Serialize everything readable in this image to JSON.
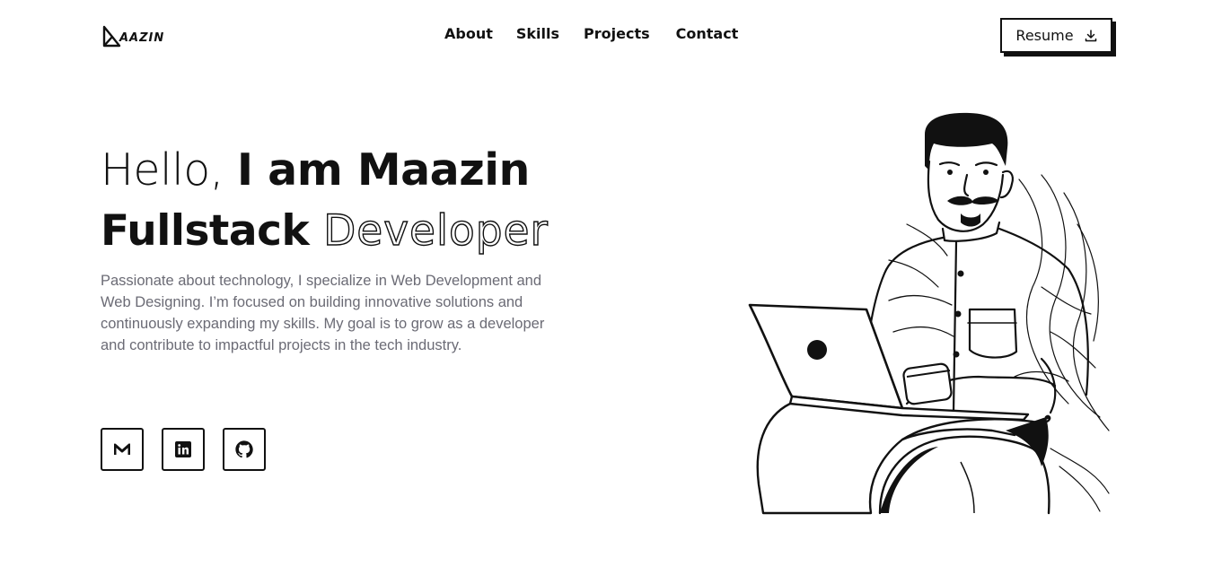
{
  "logo": {
    "text": "AAZIN",
    "icon": "m-monogram-icon"
  },
  "nav": {
    "items": [
      {
        "label": "About"
      },
      {
        "label": "Skills"
      },
      {
        "label": "Projects"
      },
      {
        "label": "Contact"
      }
    ]
  },
  "resume": {
    "label": "Resume",
    "icon": "download-icon"
  },
  "hero": {
    "greeting": "Hello,",
    "name_phrase": "I am Maazin",
    "role_bold": "Fullstack",
    "role_outline": "Developer",
    "description": "Passionate about technology, I specialize in Web Development and Web Designing. I’m focused on building innovative solutions and continuously expanding my skills. My goal is to grow as a developer and contribute to impactful projects in the tech industry."
  },
  "socials": [
    {
      "icon": "gmail-icon"
    },
    {
      "icon": "linkedin-icon"
    },
    {
      "icon": "github-icon"
    }
  ],
  "illustration": {
    "subject": "man-with-laptop-illustration"
  }
}
